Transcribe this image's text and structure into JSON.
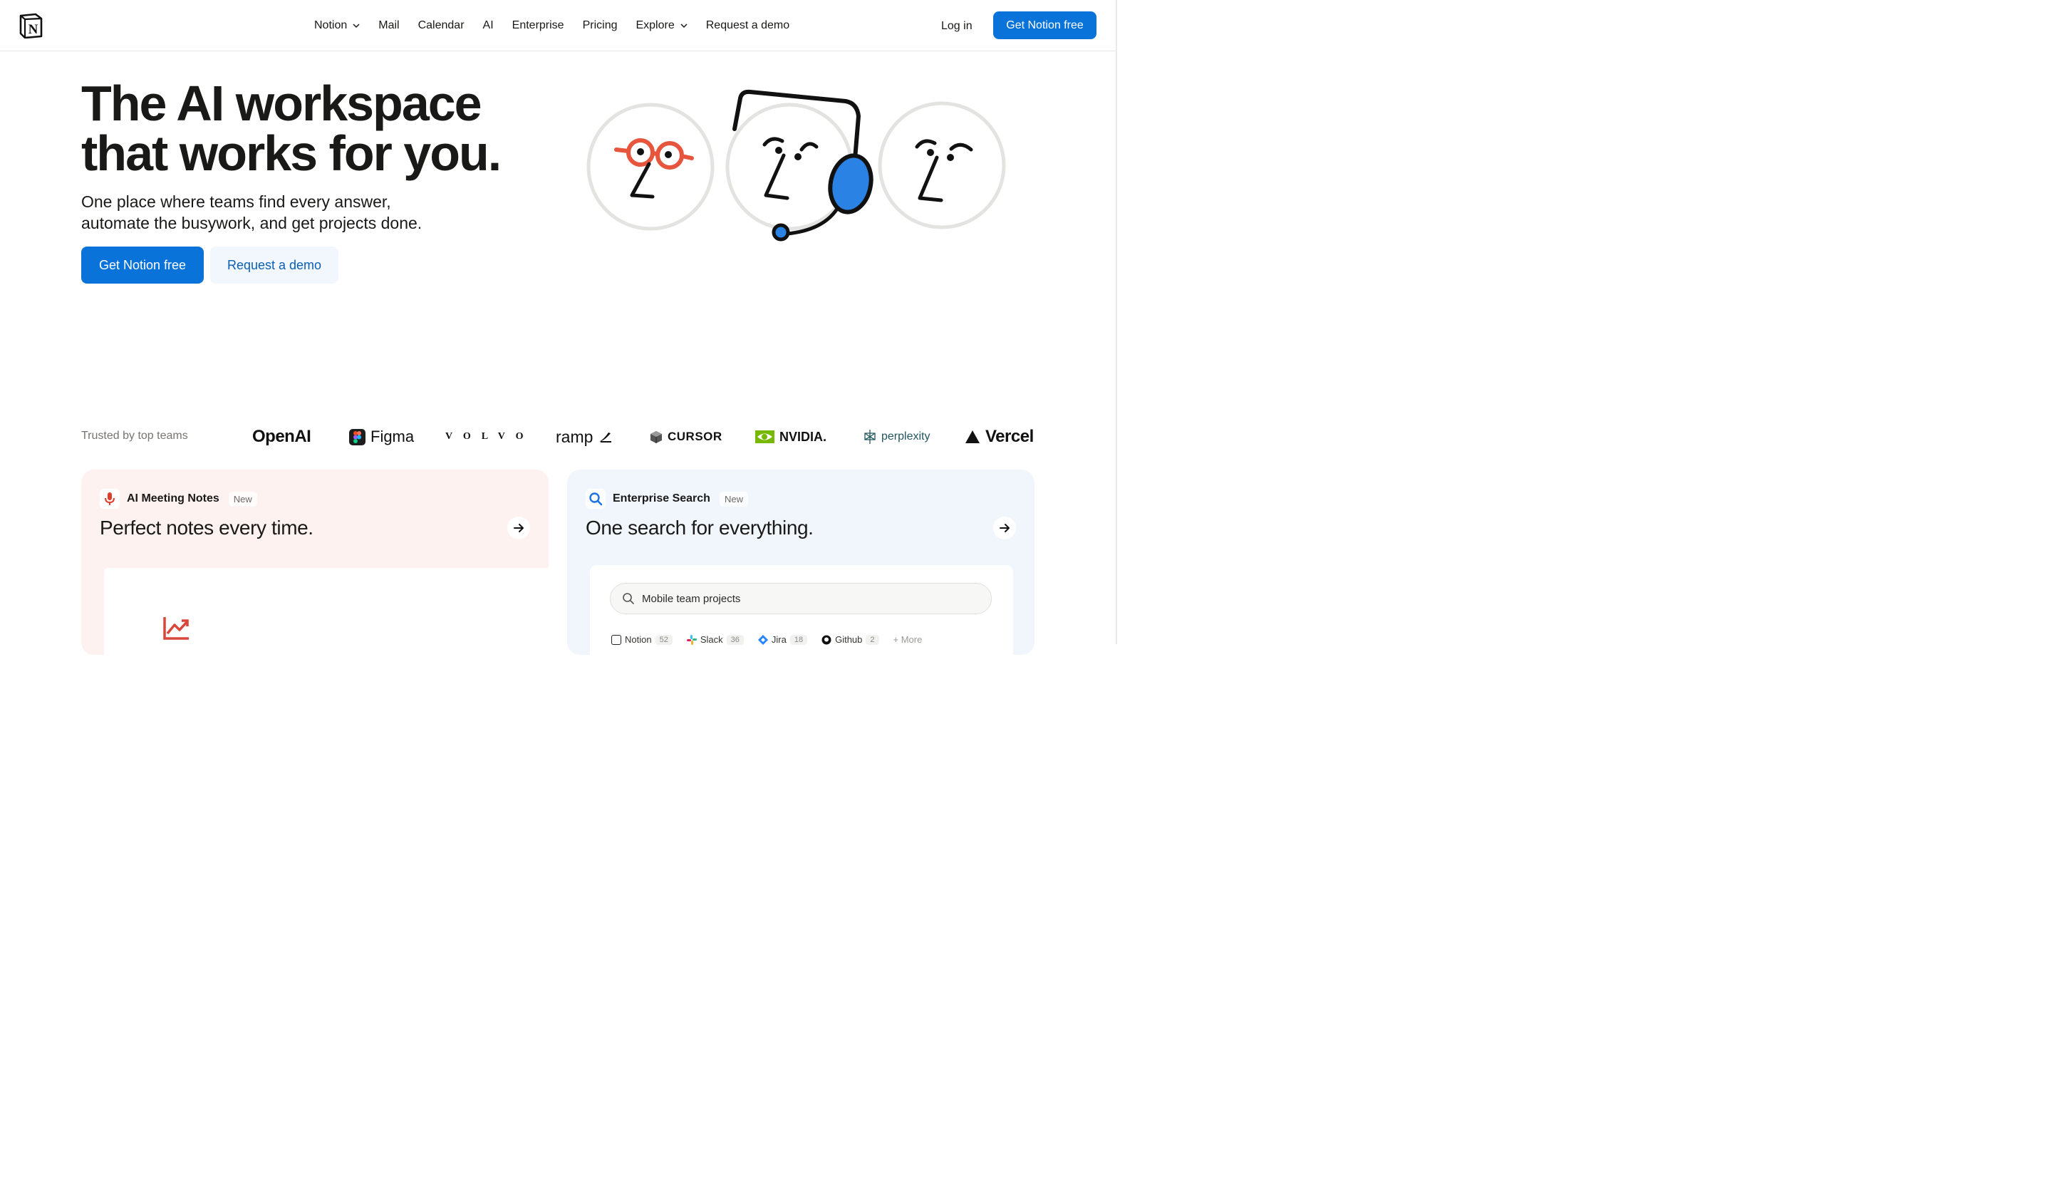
{
  "nav": {
    "links": [
      {
        "label": "Notion",
        "has_dropdown": true
      },
      {
        "label": "Mail",
        "has_dropdown": false
      },
      {
        "label": "Calendar",
        "has_dropdown": false
      },
      {
        "label": "AI",
        "has_dropdown": false
      },
      {
        "label": "Enterprise",
        "has_dropdown": false
      },
      {
        "label": "Pricing",
        "has_dropdown": false
      },
      {
        "label": "Explore",
        "has_dropdown": true
      },
      {
        "label": "Request a demo",
        "has_dropdown": false
      }
    ],
    "login_label": "Log in",
    "cta_label": "Get Notion free"
  },
  "hero": {
    "title_line1": "The AI workspace",
    "title_line2": "that works for you.",
    "subtitle_line1": "One place where teams find every answer,",
    "subtitle_line2": "automate the busywork, and get projects done.",
    "primary_cta": "Get Notion free",
    "secondary_cta": "Request a demo"
  },
  "trusted": {
    "label": "Trusted by top teams",
    "brands": [
      "OpenAI",
      "Figma",
      "VOLVO",
      "ramp",
      "CURSOR",
      "NVIDIA.",
      "perplexity",
      "Vercel"
    ]
  },
  "cards": [
    {
      "tag_label": "AI Meeting Notes",
      "tag_badge": "New",
      "heading": "Perfect notes every time.",
      "icon": "microphone-icon"
    },
    {
      "tag_label": "Enterprise Search",
      "tag_badge": "New",
      "heading": "One search for everything.",
      "icon": "search-icon",
      "search_value": "Mobile team projects",
      "sources": [
        {
          "name": "Notion",
          "count": "52"
        },
        {
          "name": "Slack",
          "count": "36"
        },
        {
          "name": "Jira",
          "count": "18"
        },
        {
          "name": "Github",
          "count": "2"
        }
      ],
      "more_label": "+ More"
    }
  ],
  "colors": {
    "brand_blue": "#0a73d9",
    "accent_red": "#e8553d",
    "card_left_bg": "#fdf2ef",
    "card_right_bg": "#f1f6fc"
  }
}
